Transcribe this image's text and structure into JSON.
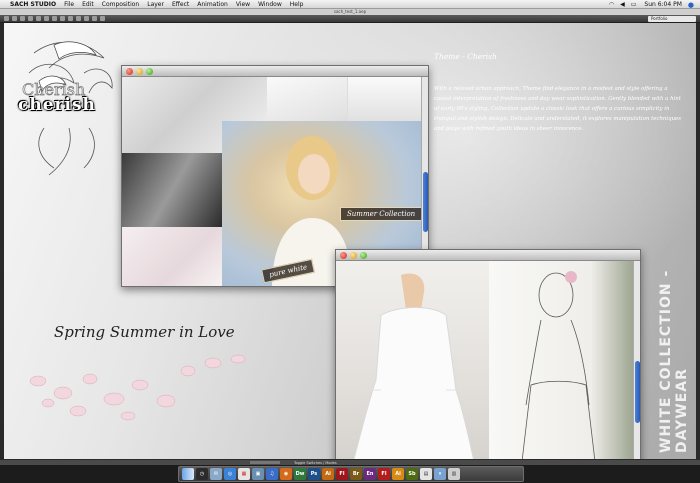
{
  "menubar": {
    "app_name": "SACH STUDIO",
    "items": [
      "File",
      "Edit",
      "Composition",
      "Layer",
      "Effect",
      "Animation",
      "View",
      "Window",
      "Help"
    ],
    "clock": "Sun 6:04 PM"
  },
  "document": {
    "title": "sach_test_1.aep"
  },
  "toolbar": {
    "workspace": "Portfolio"
  },
  "canvas": {
    "logo_text": "cherish",
    "theme_title": "Theme - Cherish",
    "theme_body": "With a relaxed urban approach, Theme find elegance in a modest and style offering a casual interpretation of freshness and day wear sophistication. Gently blended with a hint of early 90's styling, Collection update a classic look that offers a curious simplicity in tranquil and stylish design. Delicate and understated, it explores manipulation techniques and plays with refined youth ideas in sheer innocence.",
    "tagline": "Spring Summer in Love",
    "vertical_label": "WHITE COLLECTION - DAYWEAR",
    "summer_caption": "Summer Collection",
    "pure_caption": "pure white"
  },
  "statusbar": {
    "info": "Toggle Switches / Modes"
  },
  "dock": {
    "icons": [
      {
        "label": "Dw",
        "color": "#2f7a3a"
      },
      {
        "label": "Ps",
        "color": "#1d4f8a"
      },
      {
        "label": "Ai",
        "color": "#c46a12"
      },
      {
        "label": "Fl",
        "color": "#a0151b"
      },
      {
        "label": "Br",
        "color": "#7a5a18"
      },
      {
        "label": "En",
        "color": "#6a2a80"
      },
      {
        "label": "Fl",
        "color": "#b31d1d"
      },
      {
        "label": "Ai",
        "color": "#d88a12"
      },
      {
        "label": "Sb",
        "color": "#4d6b13"
      }
    ]
  },
  "colors": {
    "accent_blue": "#2a63c6",
    "scroll_thumb": "#3a6fcc"
  }
}
